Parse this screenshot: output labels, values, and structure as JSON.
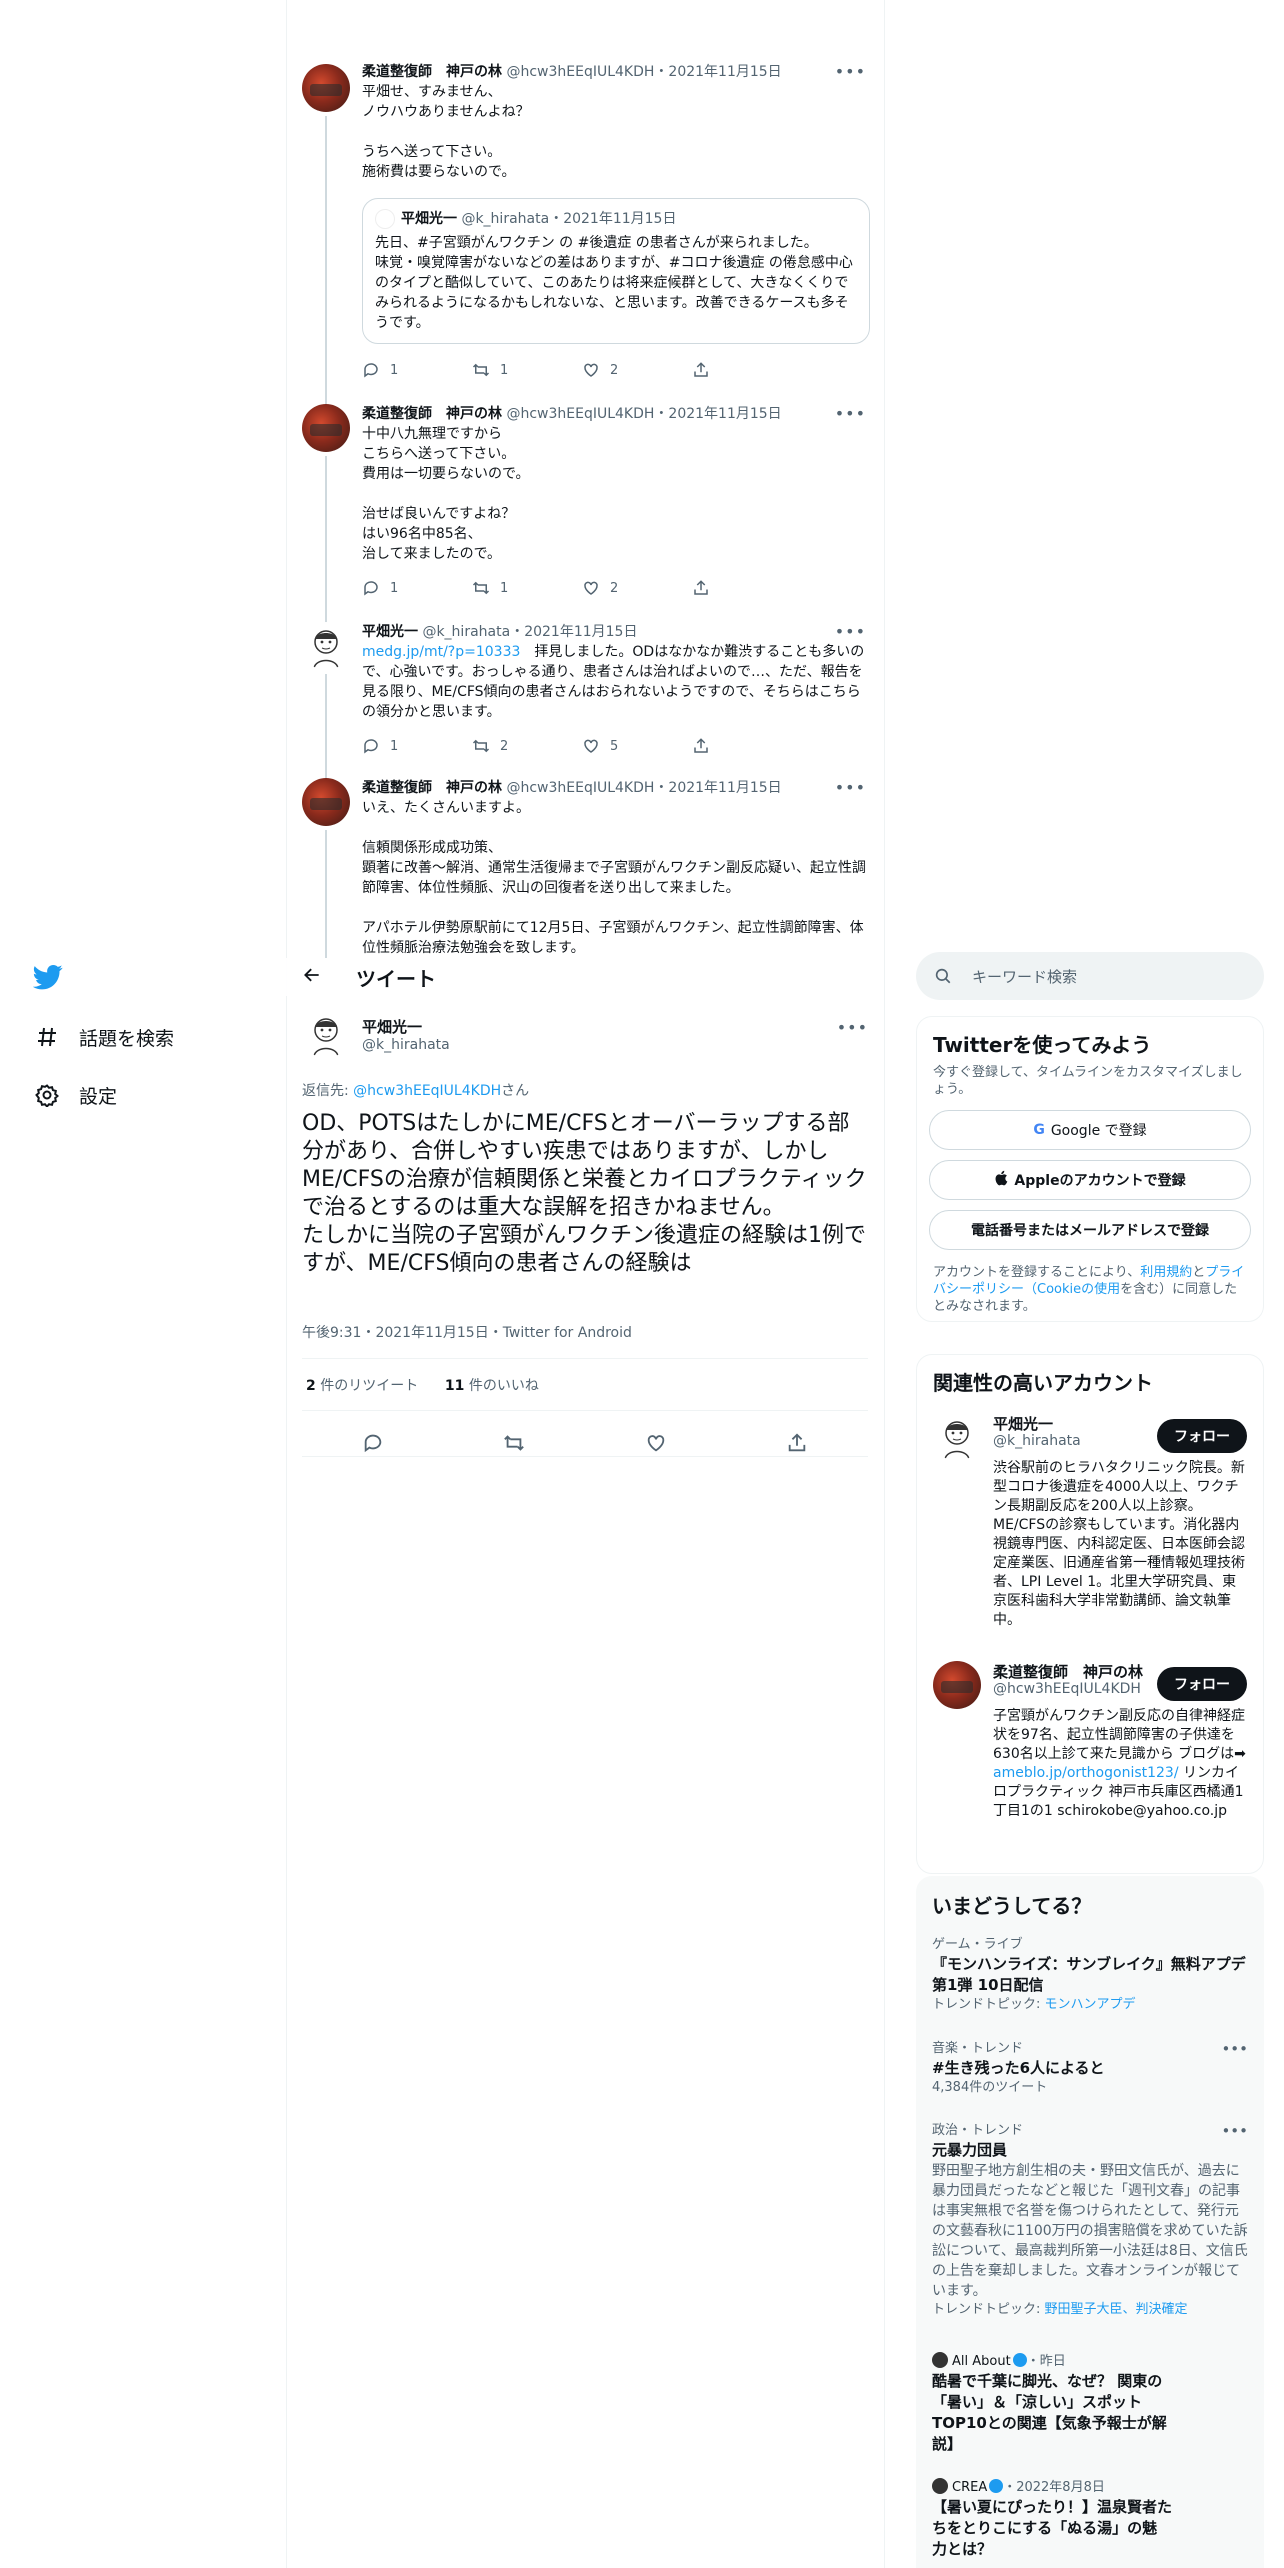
{
  "nav": {
    "explore": "話題を検索",
    "settings": "設定"
  },
  "header": {
    "title": "ツイート"
  },
  "thread": [
    {
      "name": "柔道整復師　神戸の林",
      "handle": "@hcw3hEEqIUL4KDH",
      "date": "2021年11月15日",
      "text": "平畑せ、すみません、\nノウハウありませんよね？\n\nうちへ送って下さい。\n施術費は要らないので。",
      "quote": {
        "name": "平畑光一",
        "handle": "@k_hirahata",
        "date": "2021年11月15日",
        "text": "先日、#子宮頸がんワクチン の #後遺症 の患者さんが来られました。\n味覚・嗅覚障害がないなどの差はありますが、#コロナ後遺症 の倦怠感中心のタイプと酷似していて、このあたりは将来症候群として、大きなくくりでみられるようになるかもしれないな、と思います。改善できるケースも多そうです。"
      },
      "replies": "1",
      "retweets": "1",
      "likes": "2"
    },
    {
      "name": "柔道整復師　神戸の林",
      "handle": "@hcw3hEEqIUL4KDH",
      "date": "2021年11月15日",
      "text": "十中八九無理ですから\nこちらへ送って下さい。\n費用は一切要らないので。\n\n治せば良いんですよね？\nはい96名中85名、\n治して来ましたので。",
      "replies": "1",
      "retweets": "1",
      "likes": "2"
    },
    {
      "name": "平畑光一",
      "handle": "@k_hirahata",
      "date": "2021年11月15日",
      "link": "medg.jp/mt/?p=10333",
      "text": "　拝見しました。ODはなかなか難渋することも多いので、心強いです。おっしゃる通り、患者さんは治ればよいので…、ただ、報告を見る限り、ME/CFS傾向の患者さんはおられないようですので、そちらはこちらの領分かと思います。",
      "replies": "1",
      "retweets": "2",
      "likes": "5"
    },
    {
      "name": "柔道整復師　神戸の林",
      "handle": "@hcw3hEEqIUL4KDH",
      "date": "2021年11月15日",
      "text": "いえ、たくさんいますよ。\n\n信頼関係形成成功策、\n顕著に改善〜解消、通常生活復帰まで子宮頸がんワクチン副反応疑い、起立性調節障害、体位性頻脈、沢山の回復者を送り出して来ました。\n\nアパホテル伊勢原駅前にて12月5日、子宮頸がんワクチン、起立性調節障害、体位性頻脈治療法勉強会を致します。"
    }
  ],
  "main_tweet": {
    "name": "平畑光一",
    "handle": "@k_hirahata",
    "reply_prefix": "返信先: ",
    "reply_to": "@hcw3hEEqIUL4KDH",
    "reply_suffix": "さん",
    "text": "OD、POTSはたしかにME/CFSとオーバーラップする部分があり、合併しやすい疾患ではありますが、しかしME/CFSの治療が信頼関係と栄養とカイロプラクティックで治るとするのは重大な誤解を招きかねません。\nたしかに当院の子宮頸がんワクチン後遺症の経験は1例ですが、ME/CFS傾向の患者さんの経験は",
    "timestamp": "午後9:31・2021年11月15日・Twitter for Android",
    "retweets_count": "2",
    "retweets_label": "件のリツイート",
    "likes_count": "11",
    "likes_label": "件のいいね"
  },
  "search": {
    "placeholder": "キーワード検索"
  },
  "signup": {
    "title": "Twitterを使ってみよう",
    "subtitle": "今すぐ登録して、タイムラインをカスタマイズしましょう。",
    "google": "Google で登録",
    "apple": "Appleのアカウントで登録",
    "phone": "電話番号またはメールアドレスで登録",
    "legal_1": "アカウントを登録することにより、",
    "legal_terms": "利用規約",
    "legal_2": "と",
    "legal_privacy": "プライバシーポリシー（Cookieの使用",
    "legal_3": "を含む）に同意したとみなされます。"
  },
  "related": {
    "title": "関連性の高いアカウント",
    "follow_label": "フォロー",
    "accounts": [
      {
        "name": "平畑光一",
        "handle": "@k_hirahata",
        "bio": "渋谷駅前のヒラハタクリニック院長。新型コロナ後遺症を4000人以上、ワクチン長期副反応を200人以上診察。ME/CFSの診察もしています。消化器内視鏡専門医、内科認定医、日本医師会認定産業医、旧通産省第一種情報処理技術者、LPI Level 1。北里大学研究員、東京医科歯科大学非常勤講師、論文執筆中。"
      },
      {
        "name": "柔道整復師　神戸の林",
        "handle": "@hcw3hEEqIUL4KDH",
        "bio_1": "子宮頸がんワクチン副反応の自律神経症状を97名、起立性調節障害の子供達を630名以上診て来た見識から ブログは➡ ",
        "bio_link": "ameblo.jp/orthogonist123/",
        "bio_2": " リンカイロプラクティック 神戸市兵庫区西橘通1丁目1の1 schirokobe@yahoo.co.jp"
      }
    ]
  },
  "trends": {
    "title": "いまどうしてる？",
    "items": [
      {
        "category": "ゲーム・ライブ",
        "title": "『モンハンライズ：サンブレイク』無料アプデ第1弾 10日配信",
        "sub_label": "トレンドトピック: ",
        "sub_link": "モンハンアプデ"
      },
      {
        "category": "音楽・トレンド",
        "title": "#生き残った6人によると",
        "sub": "4,384件のツイート"
      },
      {
        "category": "政治・トレンド",
        "title": "元暴力団員",
        "desc": "野田聖子地方創生相の夫・野田文信氏が、過去に暴力団員だったなどと報じた「週刊文春」の記事は事実無根で名誉を傷つけられたとして、発行元の文藝春秋に1100万円の損害賠償を求めていた訴訟について、最高裁判所第一小法廷は8日、文信氏の上告を棄却しました。文春オンラインが報じています。",
        "sub_label": "トレンドトピック: ",
        "sub_link": "野田聖子大臣、判決確定"
      },
      {
        "source": "All About",
        "when": "・昨日",
        "title": "酷暑で千葉に脚光、なぜ？ 関東の「暑い」＆「涼しい」スポット TOP10との関連【気象予報士が解説】"
      },
      {
        "source": "CREA",
        "when": "・2022年8月8日",
        "title": "【暑い夏にぴったり！】温泉賢者たちをとりこにする「ぬる湯」の魅力とは？"
      }
    ]
  },
  "colors": {
    "accent": "#1d9bf0",
    "text": "#0f1419",
    "muted": "#536471",
    "border": "#eff3f4"
  }
}
